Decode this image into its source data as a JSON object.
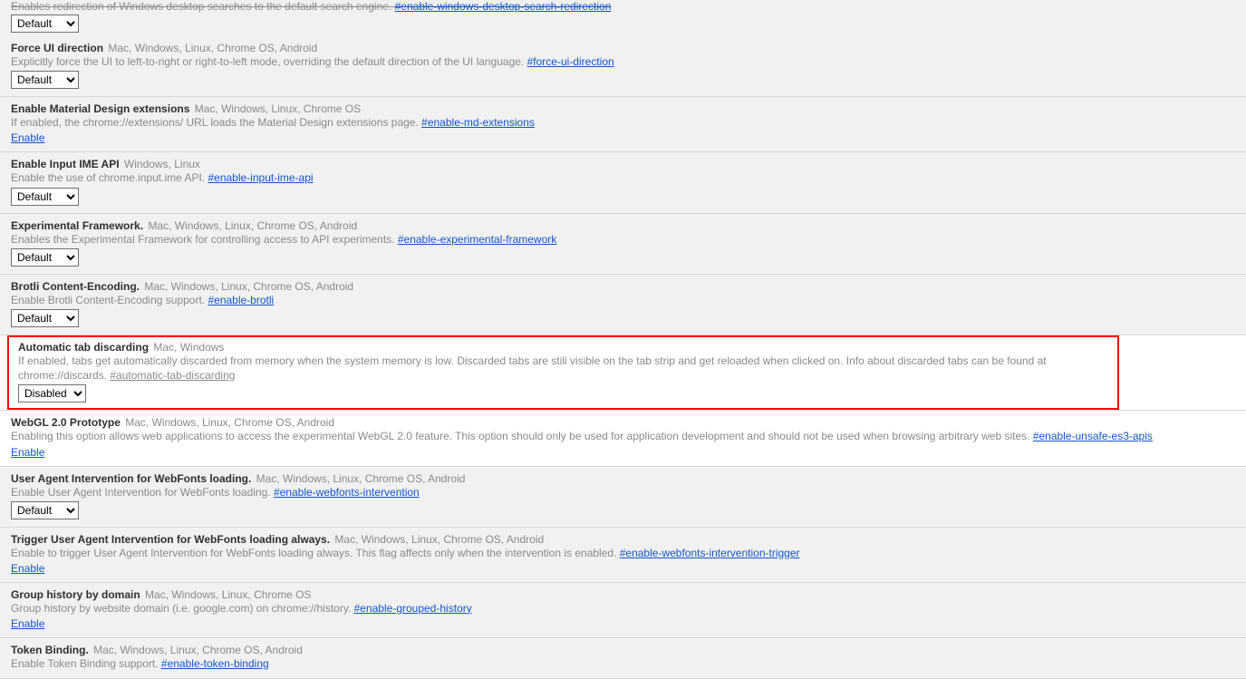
{
  "select_options": {
    "default": "Default",
    "disabled": "Disabled"
  },
  "enable_label": "Enable",
  "truncated": {
    "desc_fragment": "Enables redirection of Windows desktop searches to the default search engine. ",
    "hash": "#enable-windows-desktop-search-redirection"
  },
  "flags": [
    {
      "id": "force-ui",
      "title": "Force UI direction",
      "platforms": "Mac, Windows, Linux, Chrome OS, Android",
      "desc": "Explicitly force the UI to left-to-right or right-to-left mode, overriding the default direction of the UI language. ",
      "hash": "#force-ui-direction",
      "control": "select",
      "value": "Default",
      "bg": "grey",
      "hash_grey": false
    },
    {
      "id": "md-ext",
      "title": "Enable Material Design extensions",
      "platforms": "Mac, Windows, Linux, Chrome OS",
      "desc": "If enabled, the chrome://extensions/ URL loads the Material Design extensions page. ",
      "hash": "#enable-md-extensions",
      "control": "link",
      "bg": "grey",
      "hash_grey": false
    },
    {
      "id": "ime",
      "title": "Enable Input IME API",
      "platforms": "Windows, Linux",
      "desc": "Enable the use of chrome.input.ime API. ",
      "hash": "#enable-input-ime-api",
      "control": "select",
      "value": "Default",
      "bg": "grey",
      "hash_grey": false
    },
    {
      "id": "exp-fw",
      "title": "Experimental Framework.",
      "platforms": "Mac, Windows, Linux, Chrome OS, Android",
      "desc": "Enables the Experimental Framework for controlling access to API experiments. ",
      "hash": "#enable-experimental-framework",
      "control": "select",
      "value": "Default",
      "bg": "grey",
      "hash_grey": false
    },
    {
      "id": "brotli",
      "title": "Brotli Content-Encoding.",
      "platforms": "Mac, Windows, Linux, Chrome OS, Android",
      "desc": "Enable Brotli Content-Encoding support. ",
      "hash": "#enable-brotli",
      "control": "select",
      "value": "Default",
      "bg": "grey",
      "hash_grey": false
    },
    {
      "id": "tab-discard",
      "title": "Automatic tab discarding",
      "platforms": "Mac, Windows",
      "desc": "If enabled, tabs get automatically discarded from memory when the system memory is low. Discarded tabs are still visible on the tab strip and get reloaded when clicked on. Info about discarded tabs can be found at chrome://discards. ",
      "hash": "#automatic-tab-discarding",
      "control": "select",
      "value": "Disabled",
      "bg": "highlight",
      "hash_grey": true
    },
    {
      "id": "webgl2",
      "title": "WebGL 2.0 Prototype",
      "platforms": "Mac, Windows, Linux, Chrome OS, Android",
      "desc": "Enabling this option allows web applications to access the experimental WebGL 2.0 feature. This option should only be used for application development and should not be used when browsing arbitrary web sites. ",
      "hash": "#enable-unsafe-es3-apis",
      "control": "link",
      "bg": "white",
      "hash_grey": false
    },
    {
      "id": "webfonts",
      "title": "User Agent Intervention for WebFonts loading.",
      "platforms": "Mac, Windows, Linux, Chrome OS, Android",
      "desc": "Enable User Agent Intervention for WebFonts loading. ",
      "hash": "#enable-webfonts-intervention",
      "control": "select",
      "value": "Default",
      "bg": "grey",
      "hash_grey": false
    },
    {
      "id": "webfonts-trigger",
      "title": "Trigger User Agent Intervention for WebFonts loading always.",
      "platforms": "Mac, Windows, Linux, Chrome OS, Android",
      "desc": "Enable to trigger User Agent Intervention for WebFonts loading always. This flag affects only when the intervention is enabled. ",
      "hash": "#enable-webfonts-intervention-trigger",
      "control": "link",
      "bg": "grey",
      "hash_grey": false
    },
    {
      "id": "group-history",
      "title": "Group history by domain",
      "platforms": "Mac, Windows, Linux, Chrome OS",
      "desc": "Group history by website domain (i.e. google.com) on chrome://history. ",
      "hash": "#enable-grouped-history",
      "control": "link",
      "bg": "grey",
      "hash_grey": false
    },
    {
      "id": "token-binding",
      "title": "Token Binding.",
      "platforms": "Mac, Windows, Linux, Chrome OS, Android",
      "desc": "Enable Token Binding support. ",
      "hash": "#enable-token-binding",
      "control": "none",
      "bg": "grey",
      "hash_grey": false
    }
  ]
}
